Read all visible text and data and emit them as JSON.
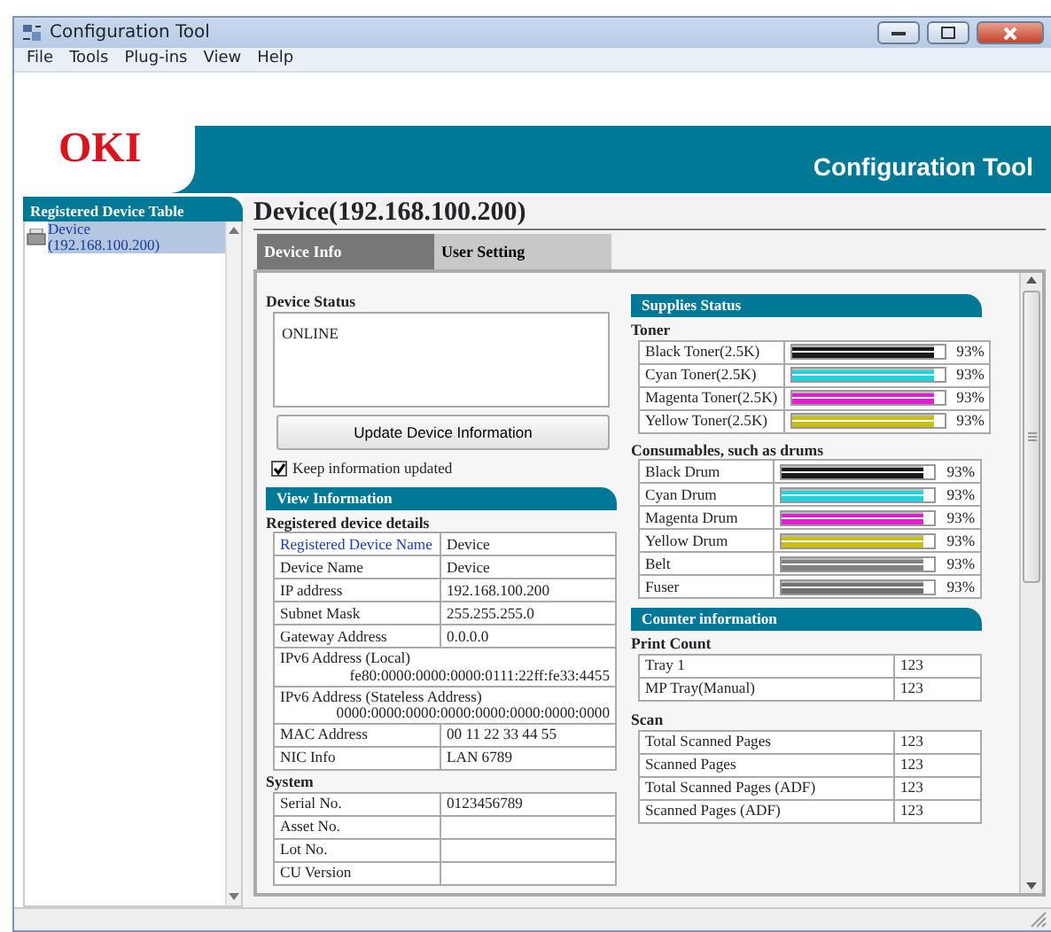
{
  "window": {
    "title": "Configuration Tool"
  },
  "menu": [
    "File",
    "Tools",
    "Plug-ins",
    "View",
    "Help"
  ],
  "banner": {
    "logo": "OKI",
    "title": "Configuration Tool"
  },
  "sidebar": {
    "title": "Registered Device Table",
    "items": [
      {
        "label": "Device",
        "address": "(192.168.100.200)",
        "selected": true
      }
    ]
  },
  "device_heading": "Device(192.168.100.200)",
  "tabs": [
    {
      "label": "Device Info",
      "selected": true
    },
    {
      "label": "User Setting",
      "selected": false
    }
  ],
  "device_status": {
    "label": "Device Status",
    "text": "ONLINE"
  },
  "update_button": "Update Device Information",
  "keep_updated": {
    "label": "Keep information updated",
    "checked": true
  },
  "view_information": {
    "title": "View Information",
    "sections": [
      {
        "title": "Registered device details",
        "rows": [
          {
            "kind": "link",
            "label": "Registered Device Name",
            "value": "Device"
          },
          {
            "kind": "pair",
            "label": "Device Name",
            "value": "Device"
          },
          {
            "kind": "pair",
            "label": "IP address",
            "value": "192.168.100.200"
          },
          {
            "kind": "pair",
            "label": "Subnet Mask",
            "value": "255.255.255.0"
          },
          {
            "kind": "pair",
            "label": "Gateway Address",
            "value": "0.0.0.0"
          },
          {
            "kind": "wide",
            "label": "IPv6 Address (Local)",
            "value": "fe80:0000:0000:0000:0111:22ff:fe33:4455"
          },
          {
            "kind": "wide",
            "label": "IPv6 Address (Stateless Address)",
            "value": "0000:0000:0000:0000:0000:0000:0000:0000"
          },
          {
            "kind": "pair",
            "label": "MAC Address",
            "value": "00 11 22 33 44 55"
          },
          {
            "kind": "pair",
            "label": "NIC Info",
            "value": "LAN 6789"
          }
        ]
      },
      {
        "title": "System",
        "rows": [
          {
            "kind": "pair",
            "label": "Serial No.",
            "value": "0123456789"
          },
          {
            "kind": "pair",
            "label": "Asset No."
          },
          {
            "kind": "pair",
            "label": "Lot No."
          },
          {
            "kind": "pair",
            "label": "CU Version"
          }
        ]
      }
    ]
  },
  "supplies_status": {
    "title": "Supplies Status",
    "groups": [
      {
        "title": "Toner",
        "items": [
          {
            "name": "Black Toner(2.5K)",
            "color": "#1a1a1a",
            "level": 0.93,
            "reading": "93%"
          },
          {
            "name": "Cyan Toner(2.5K)",
            "color": "#22d3dc",
            "level": 0.93,
            "reading": "93%"
          },
          {
            "name": "Magenta Toner(2.5K)",
            "color": "#e020d0",
            "level": 0.93,
            "reading": "93%"
          },
          {
            "name": "Yellow Toner(2.5K)",
            "color": "#c8c010",
            "level": 0.93,
            "reading": "93%"
          }
        ]
      },
      {
        "title": "Consumables, such as drums",
        "items": [
          {
            "name": "Black Drum",
            "color": "#1a1a1a",
            "level": 0.93,
            "reading": "93%"
          },
          {
            "name": "Cyan Drum",
            "color": "#22d3dc",
            "level": 0.93,
            "reading": "93%"
          },
          {
            "name": "Magenta Drum",
            "color": "#e020d0",
            "level": 0.93,
            "reading": "93%"
          },
          {
            "name": "Yellow Drum",
            "color": "#c8c010",
            "level": 0.93,
            "reading": "93%"
          },
          {
            "name": "Belt",
            "color": "#808080",
            "level": 0.93,
            "reading": "93%"
          },
          {
            "name": "Fuser",
            "color": "#707070",
            "level": 0.93,
            "reading": "93%"
          }
        ]
      }
    ]
  },
  "counter_information": {
    "title": "Counter information",
    "groups": [
      {
        "title": "Print Count",
        "rows": [
          {
            "label": "Tray 1",
            "value": "123"
          },
          {
            "label": "MP Tray(Manual)",
            "value": "123"
          }
        ]
      },
      {
        "title": "Scan",
        "rows": [
          {
            "label": "Total Scanned Pages",
            "value": "123"
          },
          {
            "label": "Scanned Pages",
            "value": "123"
          },
          {
            "label": "Total Scanned Pages (ADF)",
            "value": "123"
          },
          {
            "label": "Scanned Pages (ADF)",
            "value": "123"
          }
        ]
      }
    ]
  }
}
